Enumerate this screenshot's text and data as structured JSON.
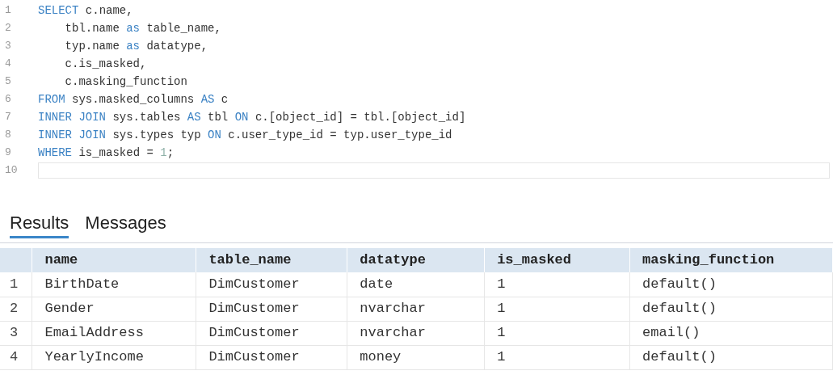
{
  "editor": {
    "lines": [
      {
        "number": "1",
        "tokens": [
          {
            "kind": "keyword",
            "text": "SELECT"
          },
          {
            "kind": "text",
            "text": " c.name,"
          }
        ]
      },
      {
        "number": "2",
        "tokens": [
          {
            "kind": "text",
            "text": "    tbl.name "
          },
          {
            "kind": "keyword",
            "text": "as"
          },
          {
            "kind": "text",
            "text": " table_name,"
          }
        ]
      },
      {
        "number": "3",
        "tokens": [
          {
            "kind": "text",
            "text": "    typ.name "
          },
          {
            "kind": "keyword",
            "text": "as"
          },
          {
            "kind": "text",
            "text": " datatype,"
          }
        ]
      },
      {
        "number": "4",
        "tokens": [
          {
            "kind": "text",
            "text": "    c.is_masked,"
          }
        ]
      },
      {
        "number": "5",
        "tokens": [
          {
            "kind": "text",
            "text": "    c.masking_function"
          }
        ]
      },
      {
        "number": "6",
        "tokens": [
          {
            "kind": "keyword",
            "text": "FROM"
          },
          {
            "kind": "text",
            "text": " sys.masked_columns "
          },
          {
            "kind": "keyword",
            "text": "AS"
          },
          {
            "kind": "text",
            "text": " c"
          }
        ]
      },
      {
        "number": "7",
        "tokens": [
          {
            "kind": "keyword",
            "text": "INNER JOIN"
          },
          {
            "kind": "text",
            "text": " sys.tables "
          },
          {
            "kind": "keyword",
            "text": "AS"
          },
          {
            "kind": "text",
            "text": " tbl "
          },
          {
            "kind": "keyword",
            "text": "ON"
          },
          {
            "kind": "text",
            "text": " c.[object_id] = tbl.[object_id]"
          }
        ]
      },
      {
        "number": "8",
        "tokens": [
          {
            "kind": "keyword",
            "text": "INNER JOIN"
          },
          {
            "kind": "text",
            "text": " sys.types typ "
          },
          {
            "kind": "keyword",
            "text": "ON"
          },
          {
            "kind": "text",
            "text": " c.user_type_id = typ.user_type_id"
          }
        ]
      },
      {
        "number": "9",
        "tokens": [
          {
            "kind": "keyword",
            "text": "WHERE"
          },
          {
            "kind": "text",
            "text": " is_masked = "
          },
          {
            "kind": "number",
            "text": "1"
          },
          {
            "kind": "text",
            "text": ";"
          }
        ]
      },
      {
        "number": "10",
        "current": true
      }
    ]
  },
  "tabs": [
    {
      "label": "Results",
      "selected": true
    },
    {
      "label": "Messages",
      "selected": false
    }
  ],
  "table": {
    "columns": [
      "",
      "name",
      "table_name",
      "datatype",
      "is_masked",
      "masking_function"
    ],
    "rows": [
      [
        "1",
        "BirthDate",
        "DimCustomer",
        "date",
        "1",
        "default()"
      ],
      [
        "2",
        "Gender",
        "DimCustomer",
        "nvarchar",
        "1",
        "default()"
      ],
      [
        "3",
        "EmailAddress",
        "DimCustomer",
        "nvarchar",
        "1",
        "email()"
      ],
      [
        "4",
        "YearlyIncome",
        "DimCustomer",
        "money",
        "1",
        "default()"
      ]
    ]
  }
}
